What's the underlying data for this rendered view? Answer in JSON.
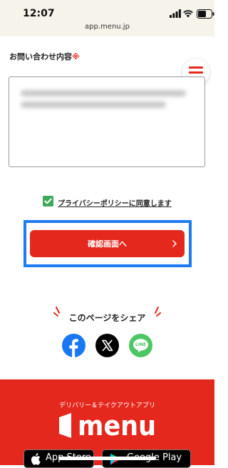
{
  "status_bar": {
    "time": "12:07"
  },
  "browser": {
    "url": "app.menu.jp"
  },
  "form": {
    "label": "お問い合わせ内容",
    "required_mark": "※",
    "consent_label": "プライバシーポリシーに同意します",
    "consent_checked": true,
    "submit_label": "確認画面へ"
  },
  "share": {
    "title": "このページをシェア",
    "networks": [
      "facebook-icon",
      "x-icon",
      "line-icon"
    ],
    "line_label": "LINE"
  },
  "footer": {
    "caption": "デリバリー＆テイクアウトアプリ",
    "brand": "menu",
    "app_store_label": "App Store",
    "google_play_label": "Google Play"
  },
  "colors": {
    "brand_red": "#e5281d",
    "highlight_blue": "#1e7bf2",
    "check_green": "#3daa5a",
    "facebook_blue": "#1877f2",
    "line_green": "#4cc764"
  }
}
